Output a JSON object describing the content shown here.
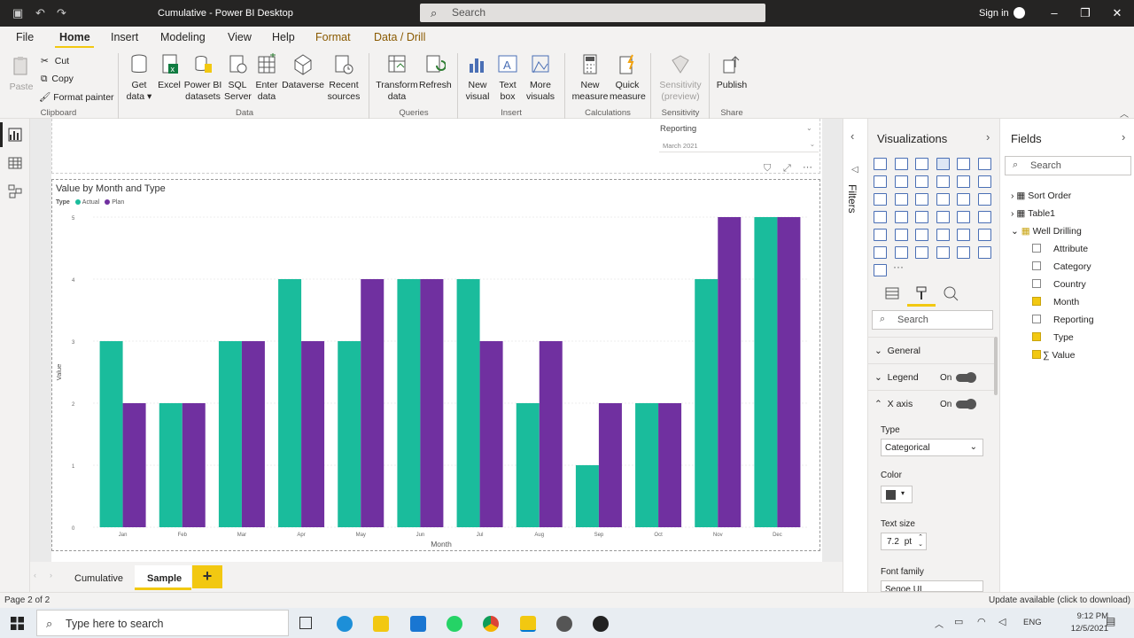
{
  "titlebar": {
    "title": "Cumulative - Power BI Desktop",
    "search_placeholder": "Search",
    "signin": "Sign in"
  },
  "tabs": [
    "File",
    "Home",
    "Insert",
    "Modeling",
    "View",
    "Help",
    "Format",
    "Data / Drill"
  ],
  "ribbon": {
    "clipboard": {
      "paste": "Paste",
      "cut": "Cut",
      "copy": "Copy",
      "format_painter": "Format painter",
      "group": "Clipboard"
    },
    "data": {
      "get_data": "Get data",
      "excel": "Excel",
      "pbi_datasets": "Power BI datasets",
      "sql": "SQL Server",
      "enter_data": "Enter data",
      "dataverse": "Dataverse",
      "recent": "Recent sources",
      "group": "Data"
    },
    "queries": {
      "transform": "Transform data",
      "refresh": "Refresh",
      "group": "Queries"
    },
    "insert": {
      "new_visual": "New visual",
      "text_box": "Text box",
      "more_visuals": "More visuals",
      "group": "Insert"
    },
    "calculations": {
      "new_measure": "New measure",
      "quick_measure": "Quick measure",
      "group": "Calculations"
    },
    "sensitivity": {
      "label": "Sensitivity (preview)",
      "group": "Sensitivity"
    },
    "share": {
      "publish": "Publish",
      "group": "Share"
    }
  },
  "slicer": {
    "title": "Reporting",
    "value": "March 2021"
  },
  "chart_data": {
    "type": "bar",
    "title": "Value by Month and Type",
    "legend_title": "Type",
    "xlabel": "Month",
    "ylabel": "Value",
    "ylim": [
      0,
      5
    ],
    "yticks": [
      "0",
      "1",
      "2",
      "3",
      "4",
      "5"
    ],
    "categories": [
      "Jan",
      "Feb",
      "Mar",
      "Apr",
      "May",
      "Jun",
      "Jul",
      "Aug",
      "Sep",
      "Oct",
      "Nov",
      "Dec"
    ],
    "series": [
      {
        "name": "Actual",
        "color": "#1abc9c",
        "values": [
          3,
          2,
          3,
          4,
          3,
          4,
          4,
          2,
          1,
          2,
          4,
          5
        ]
      },
      {
        "name": "Plan",
        "color": "#7030a0",
        "values": [
          2,
          2,
          3,
          3,
          4,
          4,
          3,
          3,
          2,
          2,
          5,
          5
        ]
      }
    ],
    "legend_position": "top-left",
    "grid": true
  },
  "pages": {
    "tabs": [
      "Cumulative",
      "Sample"
    ],
    "add": "+"
  },
  "filters": {
    "label": "Filters"
  },
  "visualizations": {
    "title": "Visualizations",
    "search_placeholder": "Search",
    "sections": {
      "general": "General",
      "legend": "Legend",
      "xaxis": "X axis",
      "on": "On"
    },
    "type_label": "Type",
    "type_value": "Categorical",
    "color_label": "Color",
    "text_size_label": "Text size",
    "text_size_value": "7.2",
    "text_size_unit": "pt",
    "font_family_label": "Font family",
    "font_family_value": "Segoe UI"
  },
  "fields": {
    "title": "Fields",
    "search_placeholder": "Search",
    "tables": [
      "Sort Order",
      "Table1",
      "Well Drilling"
    ],
    "items": [
      {
        "name": "Attribute",
        "checked": false
      },
      {
        "name": "Category",
        "checked": false
      },
      {
        "name": "Country",
        "checked": false
      },
      {
        "name": "Month",
        "checked": true
      },
      {
        "name": "Reporting",
        "checked": false
      },
      {
        "name": "Type",
        "checked": true
      },
      {
        "name": "Value",
        "checked": true
      }
    ]
  },
  "status": {
    "page": "Page 2 of 2",
    "update": "Update available (click to download)"
  },
  "taskbar": {
    "search": "Type here to search",
    "lang": "ENG",
    "time": "9:12 PM",
    "date": "12/5/2021"
  }
}
